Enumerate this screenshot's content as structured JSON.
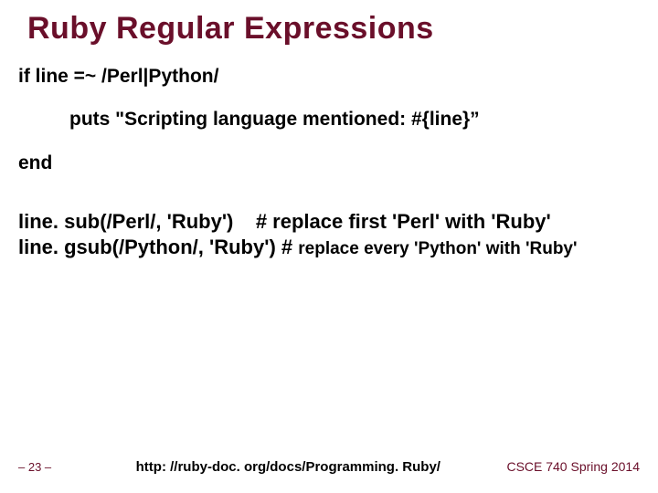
{
  "title": "Ruby Regular Expressions",
  "code": {
    "l1": "if line =~ /Perl|Python/",
    "l2": "puts \"Scripting language mentioned: #{line}”",
    "l3": "end"
  },
  "sub": {
    "l1_a": "line. sub(/Perl/, 'Ruby')    # replace first 'Perl' with 'Ruby'",
    "l2_a": "line. gsub(/Python/, 'Ruby') # ",
    "l2_b": "replace every 'Python' with 'Ruby'"
  },
  "footer": {
    "page": "– 23 –",
    "link": "http: //ruby-doc. org/docs/Programming. Ruby/",
    "course": "CSCE 740 Spring 2014"
  }
}
